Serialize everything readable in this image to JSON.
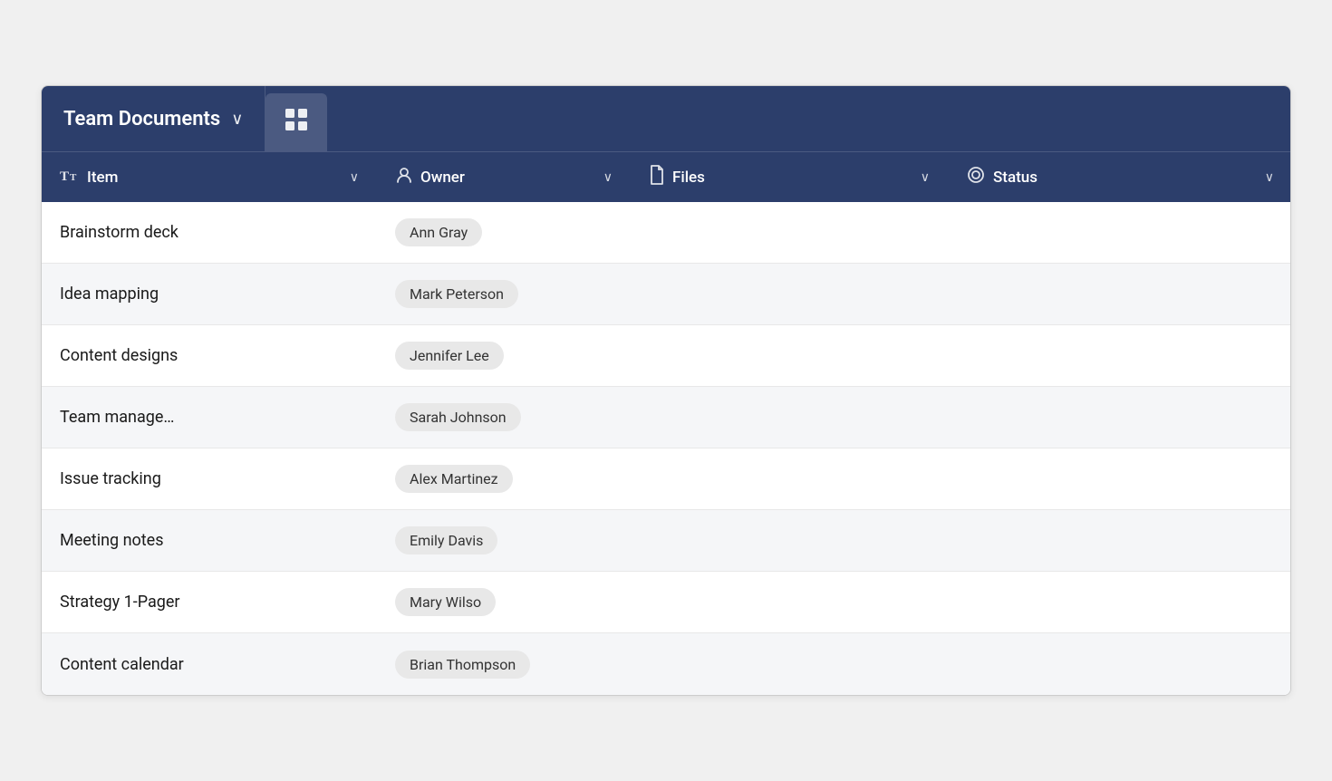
{
  "header": {
    "title": "Team Documents",
    "chevron": "∨",
    "grid_icon": "⊞"
  },
  "columns": [
    {
      "id": "item",
      "icon": "Tт",
      "label": "Item"
    },
    {
      "id": "owner",
      "icon": "👤",
      "label": "Owner"
    },
    {
      "id": "files",
      "icon": "📄",
      "label": "Files"
    },
    {
      "id": "status",
      "icon": "⊙",
      "label": "Status"
    }
  ],
  "rows": [
    {
      "item": "Brainstorm deck",
      "owner": "Ann Gray"
    },
    {
      "item": "Idea mapping",
      "owner": "Mark Peterson"
    },
    {
      "item": "Content designs",
      "owner": "Jennifer Lee"
    },
    {
      "item": "Team manage…",
      "owner": "Sarah Johnson"
    },
    {
      "item": "Issue tracking",
      "owner": "Alex Martinez"
    },
    {
      "item": "Meeting notes",
      "owner": "Emily Davis"
    },
    {
      "item": "Strategy 1-Pager",
      "owner": "Mary Wilso"
    },
    {
      "item": "Content calendar",
      "owner": "Brian Thompson"
    }
  ]
}
